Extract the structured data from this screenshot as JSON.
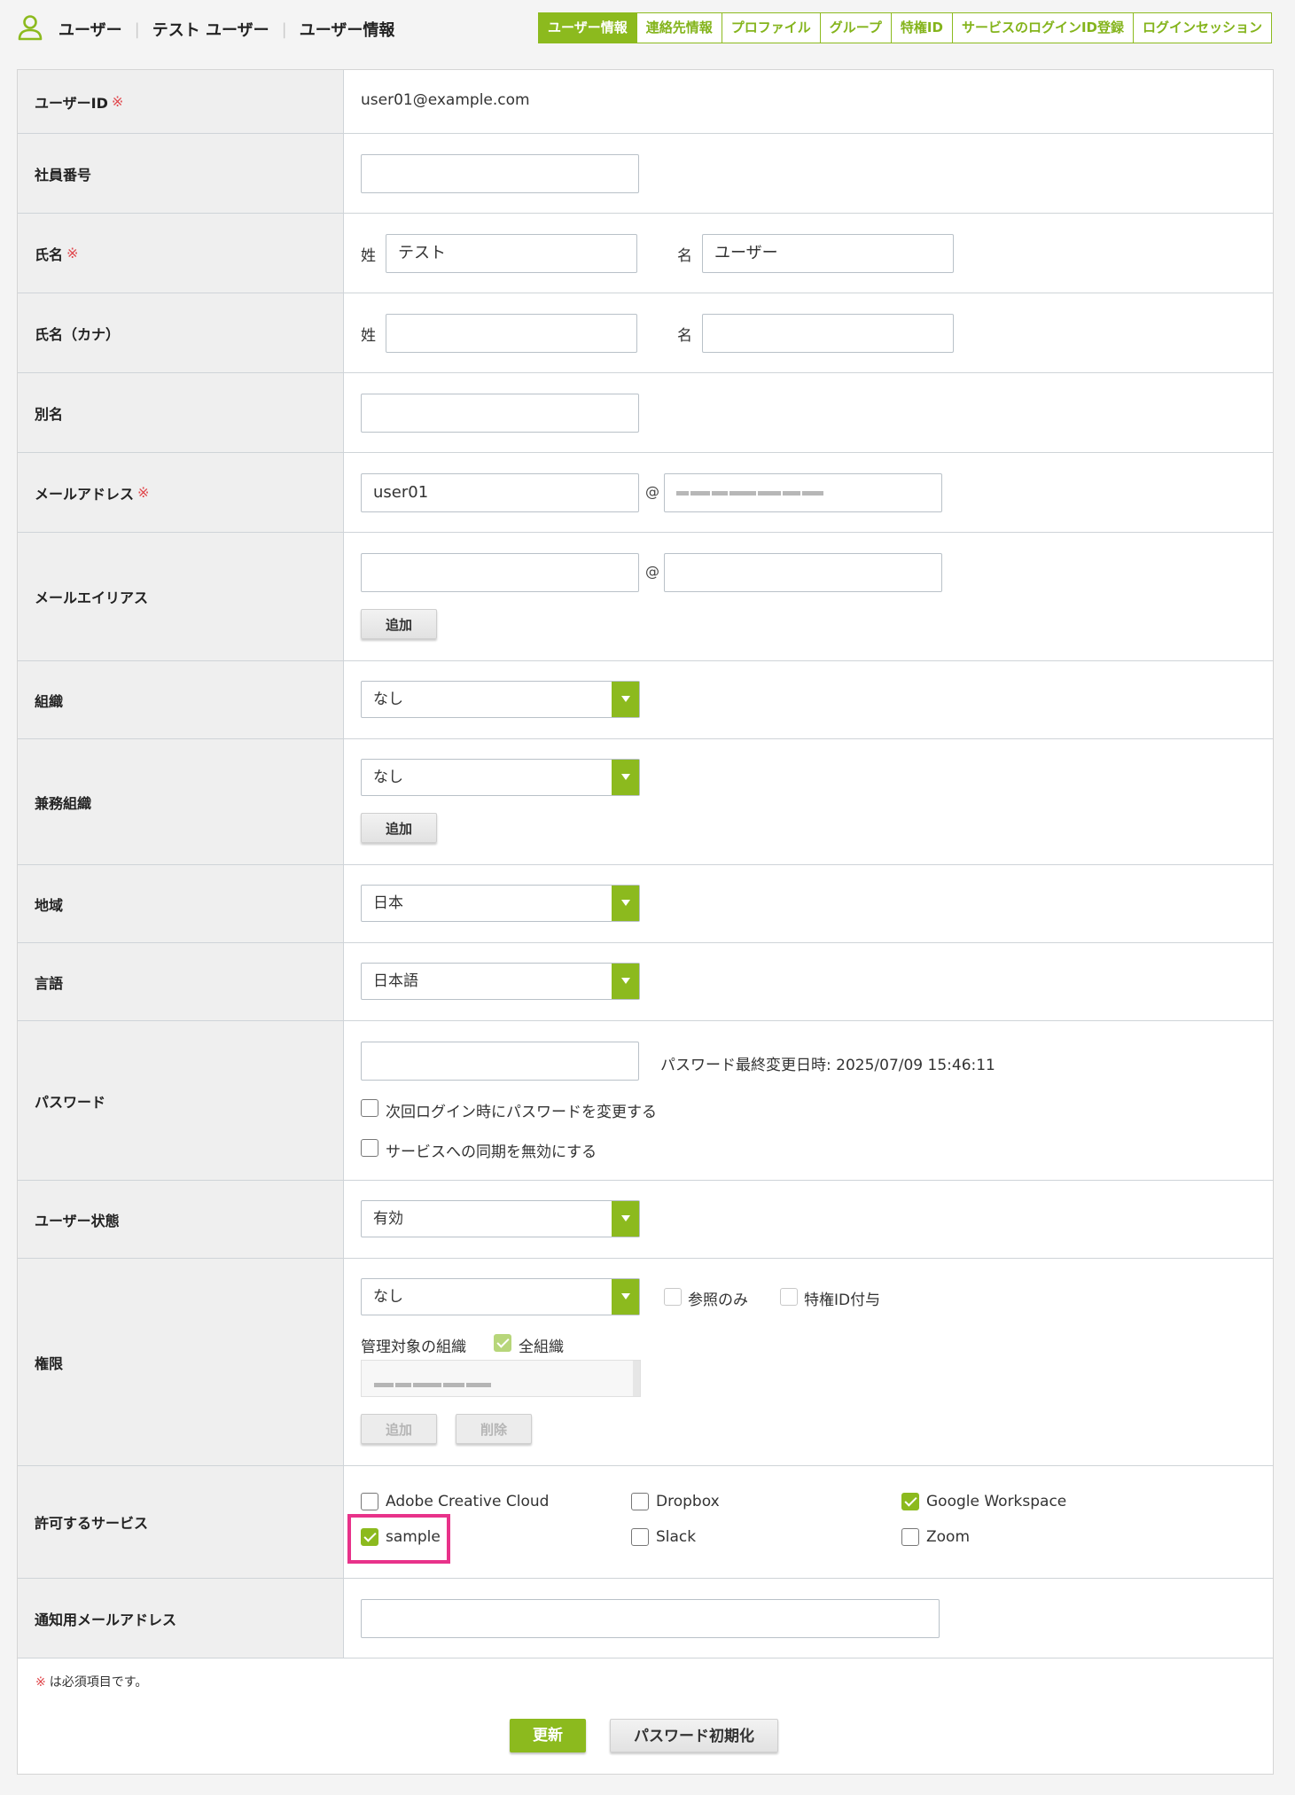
{
  "header": {
    "breadcrumb": [
      "ユーザー",
      "テスト ユーザー",
      "ユーザー情報"
    ],
    "tabs": [
      "ユーザー情報",
      "連絡先情報",
      "プロファイル",
      "グループ",
      "特権ID",
      "サービスのログインID登録",
      "ログインセッション"
    ],
    "active_tab": "ユーザー情報"
  },
  "required_mark": "※",
  "form": {
    "user_id": {
      "label": "ユーザーID",
      "value": "user01@example.com"
    },
    "employee_no": {
      "label": "社員番号",
      "value": ""
    },
    "name": {
      "label": "氏名",
      "last_label": "姓",
      "last_value": "テスト",
      "first_label": "名",
      "first_value": "ユーザー"
    },
    "name_kana": {
      "label": "氏名（カナ）",
      "last_label": "姓",
      "last_value": "",
      "first_label": "名",
      "first_value": ""
    },
    "alias": {
      "label": "別名",
      "value": ""
    },
    "email": {
      "label": "メールアドレス",
      "local": "user01",
      "at": "@",
      "domain": ""
    },
    "email_alias": {
      "label": "メールエイリアス",
      "local": "",
      "at": "@",
      "domain": "",
      "add_button": "追加"
    },
    "organization": {
      "label": "組織",
      "selected": "なし"
    },
    "secondary_org": {
      "label": "兼務組織",
      "selected": "なし",
      "add_button": "追加"
    },
    "region": {
      "label": "地域",
      "selected": "日本"
    },
    "language": {
      "label": "言語",
      "selected": "日本語"
    },
    "password": {
      "label": "パスワード",
      "value": "",
      "last_changed": "パスワード最終変更日時: 2025/07/09 15:46:11",
      "change_next_login": {
        "label": "次回ログイン時にパスワードを変更する",
        "checked": false
      },
      "disable_sync": {
        "label": "サービスへの同期を無効にする",
        "checked": false
      }
    },
    "user_status": {
      "label": "ユーザー状態",
      "selected": "有効"
    },
    "permission": {
      "label": "権限",
      "selected": "なし",
      "read_only": {
        "label": "参照のみ",
        "checked": false
      },
      "privileged_id": {
        "label": "特権ID付与",
        "checked": false
      },
      "managed_org_label": "管理対象の組織",
      "all_orgs": {
        "label": "全組織",
        "checked": true
      },
      "add_button": "追加",
      "delete_button": "削除"
    },
    "allowed_services": {
      "label": "許可するサービス",
      "items": [
        {
          "label": "Adobe Creative Cloud",
          "checked": false
        },
        {
          "label": "Dropbox",
          "checked": false
        },
        {
          "label": "Google Workspace",
          "checked": true
        },
        {
          "label": "sample",
          "checked": true
        },
        {
          "label": "Slack",
          "checked": false
        },
        {
          "label": "Zoom",
          "checked": false
        }
      ]
    },
    "notify_email": {
      "label": "通知用メールアドレス",
      "value": ""
    }
  },
  "footer": {
    "note": "は必須項目です。",
    "update_button": "更新",
    "reset_password_button": "パスワード初期化"
  },
  "colors": {
    "accent": "#8cba1e",
    "required": "#e0484d",
    "highlight": "#e8328a"
  }
}
